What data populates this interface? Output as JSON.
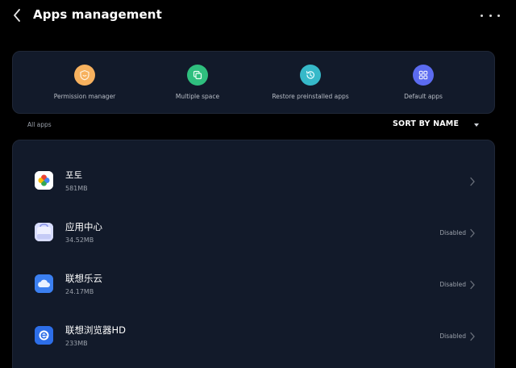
{
  "header": {
    "title": "Apps management"
  },
  "shortcuts": [
    {
      "label": "Permission manager",
      "icon": "shield-icon",
      "color": "#f7b15e"
    },
    {
      "label": "Multiple space",
      "icon": "duplicate-icon",
      "color": "#2fbf7e"
    },
    {
      "label": "Restore preinstalled apps",
      "icon": "history-icon",
      "color": "#36b9c9"
    },
    {
      "label": "Default apps",
      "icon": "grid-icon",
      "color": "#5b6bf0"
    }
  ],
  "list": {
    "section_label": "All apps",
    "sort_label": "SORT BY NAME"
  },
  "apps": [
    {
      "name": "포토",
      "size": "581MB",
      "status": "",
      "icon": "photos-icon"
    },
    {
      "name": "应用中心",
      "size": "34.52MB",
      "status": "Disabled",
      "icon": "app-center-icon"
    },
    {
      "name": "联想乐云",
      "size": "24.17MB",
      "status": "Disabled",
      "icon": "cloud-icon"
    },
    {
      "name": "联想浏览器HD",
      "size": "233MB",
      "status": "Disabled",
      "icon": "browser-icon"
    }
  ]
}
